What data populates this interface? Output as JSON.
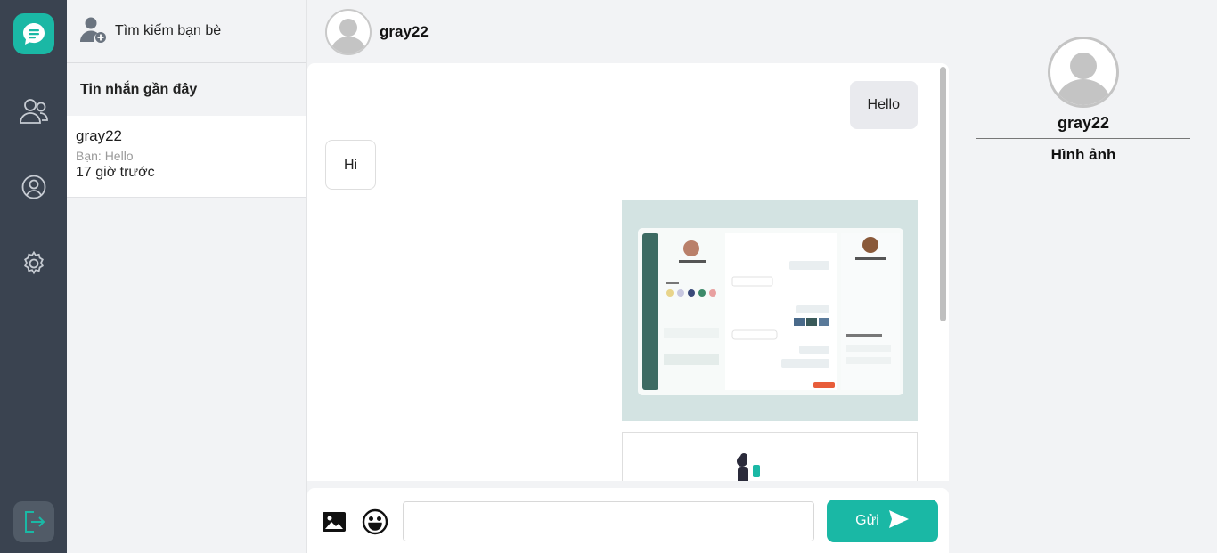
{
  "rail": {
    "items": [
      {
        "icon": "chat-bubble-icon",
        "active": true
      },
      {
        "icon": "users-icon"
      },
      {
        "icon": "user-circle-icon"
      },
      {
        "icon": "gear-icon"
      }
    ],
    "logout_icon": "logout-icon",
    "bg_color": "#3a4350",
    "accent_color": "#1ab8a5"
  },
  "contacts": {
    "search_friends_label": "Tìm kiếm bạn bè",
    "recent_title": "Tin nhắn gần đây",
    "conversations": [
      {
        "name": "gray22",
        "preview": "Bạn: Hello",
        "time": "17 giờ trước"
      }
    ]
  },
  "chat": {
    "header_name": "gray22",
    "messages": [
      {
        "direction": "out",
        "type": "text",
        "text": "Hello"
      },
      {
        "direction": "in",
        "type": "text",
        "text": "Hi"
      },
      {
        "direction": "out",
        "type": "image",
        "description": "chat-app-screenshot"
      },
      {
        "direction": "out",
        "type": "image",
        "description": "illustration"
      }
    ]
  },
  "composer": {
    "image_icon": "image-icon",
    "emoji_icon": "emoji-icon",
    "input_value": "",
    "input_placeholder": "",
    "send_label": "Gửi",
    "send_icon": "send-icon"
  },
  "profile": {
    "name": "gray22",
    "media_title": "Hình ảnh"
  }
}
